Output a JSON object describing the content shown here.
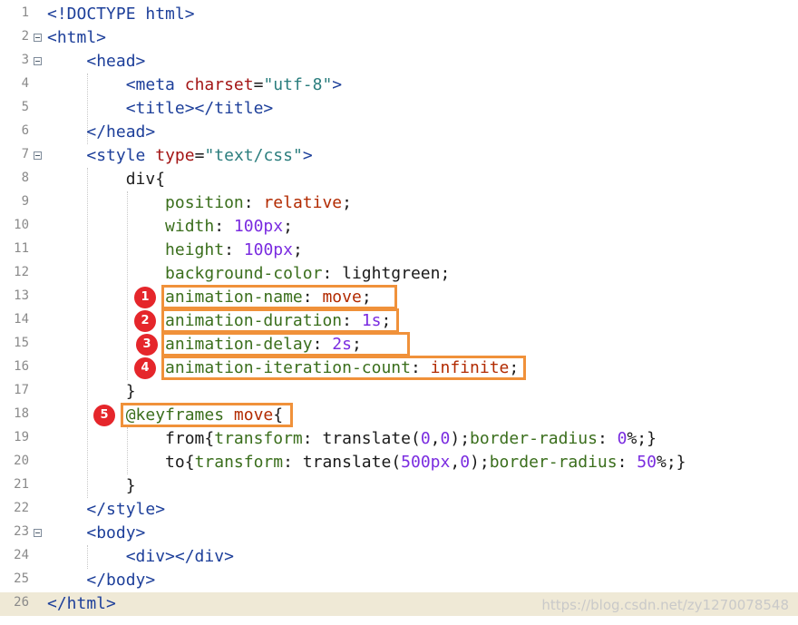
{
  "editor": {
    "lines": [
      {
        "n": "1",
        "code": "<span class=\"tag\">&lt;!DOCTYPE html&gt;</span>"
      },
      {
        "n": "2",
        "code": "<span class=\"tag\">&lt;html&gt;</span>"
      },
      {
        "n": "3",
        "code": "    <span class=\"tag\">&lt;head&gt;</span>"
      },
      {
        "n": "4",
        "code": "        <span class=\"tag\">&lt;meta</span> <span class=\"attr\">charset</span>=<span class=\"str\">\"utf-8\"</span><span class=\"tag\">&gt;</span>"
      },
      {
        "n": "5",
        "code": "        <span class=\"tag\">&lt;title&gt;&lt;/title&gt;</span>"
      },
      {
        "n": "6",
        "code": "    <span class=\"tag\">&lt;/head&gt;</span>"
      },
      {
        "n": "7",
        "code": "    <span class=\"tag\">&lt;style</span> <span class=\"attr\">type</span>=<span class=\"str\">\"text/css\"</span><span class=\"tag\">&gt;</span>"
      },
      {
        "n": "8",
        "code": "        <span class=\"sel\">div{</span>"
      },
      {
        "n": "9",
        "code": "            <span class=\"prop\">position</span>: <span class=\"val\">relative</span>;"
      },
      {
        "n": "10",
        "code": "            <span class=\"prop\">width</span>: <span class=\"num\">100px</span>;"
      },
      {
        "n": "11",
        "code": "            <span class=\"prop\">height</span>: <span class=\"num\">100px</span>;"
      },
      {
        "n": "12",
        "code": "            <span class=\"prop\">background-color</span>: lightgreen;"
      },
      {
        "n": "13",
        "code": "            <span class=\"prop\">animation-name</span>: <span class=\"val\">move</span>;"
      },
      {
        "n": "14",
        "code": "            <span class=\"prop\">animation-duration</span>: <span class=\"num\">1s</span>;"
      },
      {
        "n": "15",
        "code": "            <span class=\"prop\">animation-delay</span>: <span class=\"num\">2s</span>;"
      },
      {
        "n": "16",
        "code": "            <span class=\"prop\">animation-iteration-count</span>: <span class=\"val\">infinite</span>;"
      },
      {
        "n": "17",
        "code": "        }"
      },
      {
        "n": "18",
        "code": "        <span class=\"prop\">@keyframes</span> <span class=\"val\">move</span>{"
      },
      {
        "n": "19",
        "code": "            from{<span class=\"prop\">transform</span>: translate(<span class=\"num\">0</span>,<span class=\"num\">0</span>);<span class=\"prop\">border-radius</span>: <span class=\"num\">0</span>%;}"
      },
      {
        "n": "20",
        "code": "            to{<span class=\"prop\">transform</span>: translate(<span class=\"num\">500px</span>,<span class=\"num\">0</span>);<span class=\"prop\">border-radius</span>: <span class=\"num\">50</span>%;}"
      },
      {
        "n": "21",
        "code": "        }"
      },
      {
        "n": "22",
        "code": "    <span class=\"tag\">&lt;/style&gt;</span>"
      },
      {
        "n": "23",
        "code": "    <span class=\"tag\">&lt;body&gt;</span>"
      },
      {
        "n": "24",
        "code": "        <span class=\"tag\">&lt;div&gt;&lt;/div&gt;</span>"
      },
      {
        "n": "25",
        "code": "    <span class=\"tag\">&lt;/body&gt;</span>"
      },
      {
        "n": "26",
        "code": "<span class=\"tag\">&lt;/html&gt;</span>"
      }
    ],
    "fold_lines": [
      "2",
      "3",
      "7",
      "23"
    ],
    "current_line": "26",
    "colors": {
      "tag": "#1d3f9a",
      "attr": "#a31515",
      "string": "#2a7d7d",
      "property": "#3a6e1c",
      "value": "#b22a00",
      "number": "#7a2ce0",
      "annotation_box": "#f0913a",
      "annotation_badge": "#e5262b",
      "current_line_bg": "#efe9d6"
    }
  },
  "annotations": [
    {
      "label": "1",
      "line": "13"
    },
    {
      "label": "2",
      "line": "14"
    },
    {
      "label": "3",
      "line": "15"
    },
    {
      "label": "4",
      "line": "16"
    },
    {
      "label": "5",
      "line": "18"
    }
  ],
  "watermark": "https://blog.csdn.net/zy1270078548"
}
